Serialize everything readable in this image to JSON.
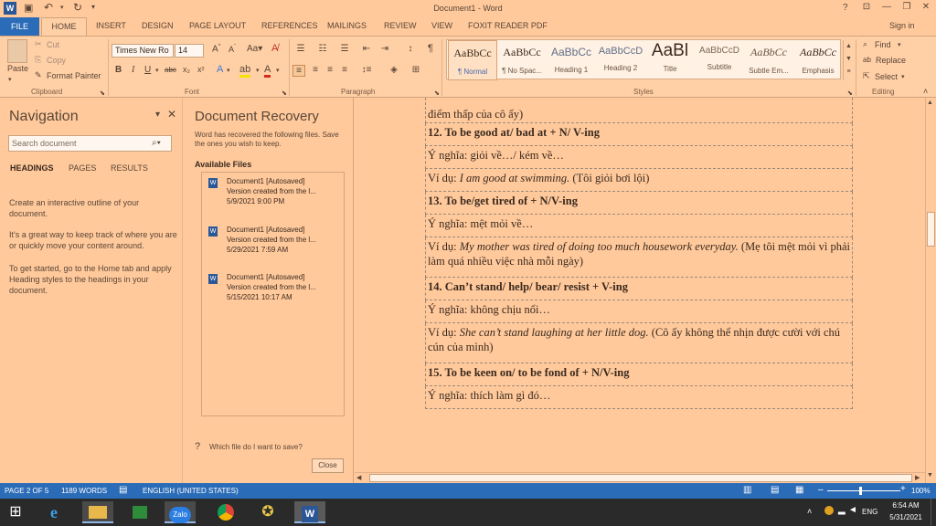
{
  "window": {
    "title": "Document1 - Word",
    "help": "?",
    "sign_in": "Sign in"
  },
  "qat": {
    "save_icon": "save-icon",
    "undo_icon": "undo-icon",
    "redo_icon": "redo-icon"
  },
  "tabs": [
    "FILE",
    "HOME",
    "INSERT",
    "DESIGN",
    "PAGE LAYOUT",
    "REFERENCES",
    "MAILINGS",
    "REVIEW",
    "VIEW",
    "FOXIT READER PDF"
  ],
  "clipboard": {
    "paste": "Paste",
    "cut": "Cut",
    "copy": "Copy",
    "format_painter": "Format Painter",
    "label": "Clipboard"
  },
  "font": {
    "name": "Times New Ro",
    "size": "14",
    "label": "Font"
  },
  "paragraph": {
    "label": "Paragraph"
  },
  "styles": {
    "label": "Styles",
    "items": [
      {
        "sample": "AaBbCc",
        "name": "¶ Normal"
      },
      {
        "sample": "AaBbCc",
        "name": "¶ No Spac..."
      },
      {
        "sample": "AaBbCc",
        "name": "Heading 1"
      },
      {
        "sample": "AaBbCcD",
        "name": "Heading 2"
      },
      {
        "sample": "AaBl",
        "name": "Title"
      },
      {
        "sample": "AaBbCcD",
        "name": "Subtitle"
      },
      {
        "sample": "AaBbCc",
        "name": "Subtle Em..."
      },
      {
        "sample": "AaBbCc",
        "name": "Emphasis"
      }
    ]
  },
  "editing": {
    "find": "Find",
    "replace": "Replace",
    "select": "Select",
    "label": "Editing"
  },
  "navigation": {
    "title": "Navigation",
    "search_placeholder": "Search document",
    "tabs": [
      "HEADINGS",
      "PAGES",
      "RESULTS"
    ],
    "text1": "Create an interactive outline of your document.",
    "text2": "It's a great way to keep track of where you are or quickly move your content around.",
    "text3": "To get started, go to the Home tab and apply Heading styles to the headings in your document."
  },
  "recovery": {
    "title": "Document Recovery",
    "desc": "Word has recovered the following files. Save the ones you wish to keep.",
    "available": "Available Files",
    "files": [
      {
        "name": "Document1  [Autosaved]",
        "version": "Version created from the l...",
        "date": "5/9/2021 9:00 PM"
      },
      {
        "name": "Document1  [Autosaved]",
        "version": "Version created from the l...",
        "date": "5/29/2021 7:59 AM"
      },
      {
        "name": "Document1  [Autosaved]",
        "version": "Version created from the l...",
        "date": "5/15/2021 10:17 AM"
      }
    ],
    "help_link": "Which file do I want to save?",
    "close": "Close"
  },
  "doc": {
    "top_partial": "điểm thấp của cô ấy)",
    "rows": [
      {
        "bold": "12. To be good at/ bad at + N/ V-ing"
      },
      {
        "text": "Ý nghĩa: giỏi về…/ kém về…"
      },
      {
        "pre": "Ví dụ: ",
        "italic": "I am good at swimming.",
        "post": " (Tôi giỏi bơi lội)"
      },
      {
        "bold": "13. To be/get tired of + N/V-ing"
      },
      {
        "text": "Ý nghĩa: mệt mỏi về…"
      },
      {
        "pre": "Ví dụ: ",
        "italic": "My mother was tired of doing too much housework everyday.",
        "post": " (Mẹ tôi mệt mỏi vì phải làm quá nhiều việc nhà mỗi ngày)"
      },
      {
        "bold": "14. Can’t stand/ help/ bear/ resist + V-ing"
      },
      {
        "text": "Ý nghĩa: không chịu nổi…"
      },
      {
        "pre": "Ví dụ: ",
        "italic": "She can’t stand laughing at her little dog.",
        "post": " (Cô ấy không thể nhịn được cười với chú cún của mình)"
      },
      {
        "bold": "15. To be keen on/ to be fond of + N/V-ing"
      },
      {
        "text": "Ý nghĩa: thích làm gì đó…"
      }
    ]
  },
  "status": {
    "page": "PAGE 2 OF 5",
    "words": "1189 WORDS",
    "language": "ENGLISH (UNITED STATES)",
    "zoom": "100%"
  },
  "taskbar": {
    "lang": "ENG",
    "time": "6:54 AM",
    "date": "5/31/2021",
    "zalo": "Zalo"
  },
  "colors": {
    "accent": "#2b6cb8",
    "background": "#ffc99c",
    "taskbar": "#2a2a2a"
  }
}
